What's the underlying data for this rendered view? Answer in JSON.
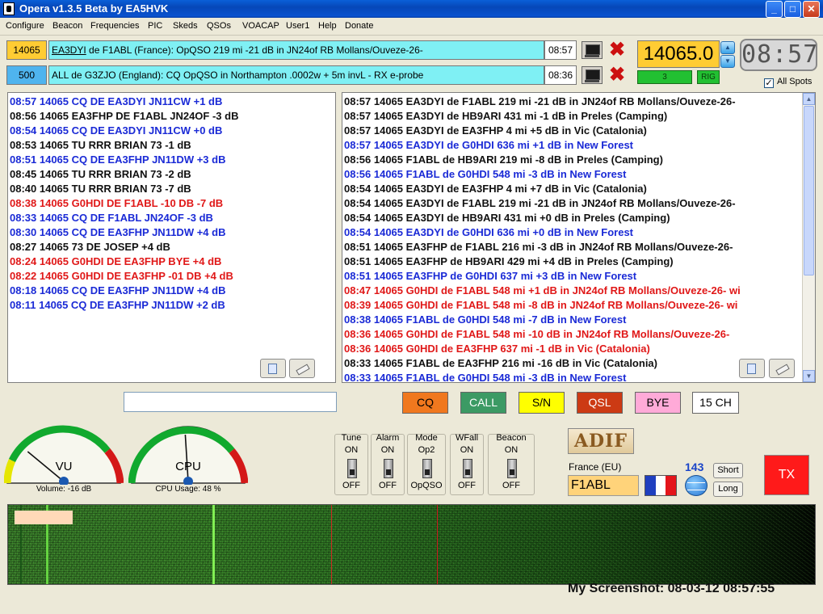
{
  "titlebar": {
    "title": "Opera v1.3.5 Beta    by EA5HVK",
    "min": "_",
    "max": "□",
    "close": "✕"
  },
  "menu": [
    "Configure",
    "Beacon",
    "Frequencies",
    "PIC",
    "Skeds",
    "QSOs",
    "VOACAP",
    "User1",
    "Help",
    "Donate"
  ],
  "rx1": {
    "freq": "14065",
    "freq_bg": "#ffcc33",
    "call": "EA3DYI",
    "message": " de F1ABL (France): OpQSO 219 mi -21 dB in JN24of RB Mollans/Ouveze-26-",
    "time": "08:57"
  },
  "rx2": {
    "freq": "500",
    "freq_bg": "#4fb4ee",
    "message": "ALL de G3ZJO (England): CQ OpQSO in Northampton .0002w + 5m invL - RX e-probe",
    "time": "08:36"
  },
  "frequency_display": "14065.0",
  "clock": "08:57",
  "rig_count": "3",
  "rig_label": "RIG",
  "all_spots": {
    "label": "All Spots",
    "checked": true
  },
  "left_log": [
    {
      "text": "08:57 14065 CQ DE EA3DYI JN11CW +1 dB",
      "color": "blue"
    },
    {
      "text": "08:56 14065 EA3FHP DE F1ABL JN24OF -3 dB",
      "color": "black"
    },
    {
      "text": "08:54 14065 CQ DE EA3DYI JN11CW +0 dB",
      "color": "blue"
    },
    {
      "text": "08:53 14065 TU RRR BRIAN 73 -1 dB",
      "color": "black"
    },
    {
      "text": "08:51 14065 CQ DE EA3FHP JN11DW +3 dB",
      "color": "blue"
    },
    {
      "text": "08:45 14065 TU RRR BRIAN 73 -2 dB",
      "color": "black"
    },
    {
      "text": "08:40 14065 TU RRR BRIAN 73 -7 dB",
      "color": "black"
    },
    {
      "text": "08:38 14065 G0HDI DE F1ABL -10 DB -7 dB",
      "color": "red"
    },
    {
      "text": "08:33 14065 CQ DE F1ABL JN24OF -3 dB",
      "color": "blue"
    },
    {
      "text": "08:30 14065 CQ DE EA3FHP JN11DW +4 dB",
      "color": "blue"
    },
    {
      "text": "08:27 14065 73 DE JOSEP      +4 dB",
      "color": "black"
    },
    {
      "text": "08:24 14065 G0HDI DE EA3FHP BYE +4 dB",
      "color": "red"
    },
    {
      "text": "08:22 14065 G0HDI DE EA3FHP -01 DB +4 dB",
      "color": "red"
    },
    {
      "text": "08:18 14065 CQ DE EA3FHP JN11DW +4 dB",
      "color": "blue"
    },
    {
      "text": "08:11 14065 CQ DE EA3FHP JN11DW +2 dB",
      "color": "blue"
    }
  ],
  "right_log": [
    {
      "text": "08:57 14065 EA3DYI de F1ABL 219 mi -21 dB in JN24of RB Mollans/Ouveze-26-",
      "color": "black"
    },
    {
      "text": "08:57 14065 EA3DYI de HB9ARI 431 mi -1 dB in Preles (Camping)",
      "color": "black"
    },
    {
      "text": "08:57 14065 EA3DYI de EA3FHP 4 mi +5 dB in Vic (Catalonia)",
      "color": "black"
    },
    {
      "text": "08:57 14065 EA3DYI de G0HDI 636 mi +1 dB in New Forest",
      "color": "blue"
    },
    {
      "text": "08:56 14065 F1ABL de HB9ARI 219 mi -8 dB in Preles (Camping)",
      "color": "black"
    },
    {
      "text": "08:56 14065 F1ABL de G0HDI 548 mi -3 dB in New Forest",
      "color": "blue"
    },
    {
      "text": "08:54 14065 EA3DYI de EA3FHP 4 mi +7 dB in Vic (Catalonia)",
      "color": "black"
    },
    {
      "text": "08:54 14065 EA3DYI de F1ABL 219 mi -21 dB in JN24of RB Mollans/Ouveze-26-",
      "color": "black"
    },
    {
      "text": "08:54 14065 EA3DYI de HB9ARI 431 mi +0 dB in Preles (Camping)",
      "color": "black"
    },
    {
      "text": "08:54 14065 EA3DYI de G0HDI 636 mi +0 dB in New Forest",
      "color": "blue"
    },
    {
      "text": "08:51 14065 EA3FHP de F1ABL 216 mi -3 dB in JN24of RB Mollans/Ouveze-26-",
      "color": "black"
    },
    {
      "text": "08:51 14065 EA3FHP de HB9ARI 429 mi +4 dB in Preles (Camping)",
      "color": "black"
    },
    {
      "text": "08:51 14065 EA3FHP de G0HDI 637 mi +3 dB in New Forest",
      "color": "blue"
    },
    {
      "text": "08:47 14065 G0HDI de F1ABL 548 mi +1 dB in JN24of RB Mollans/Ouveze-26- wi",
      "color": "red"
    },
    {
      "text": "08:39 14065 G0HDI de F1ABL 548 mi -8 dB in JN24of RB Mollans/Ouveze-26- wi",
      "color": "red"
    },
    {
      "text": "08:38 14065 F1ABL de G0HDI 548 mi -7 dB in New Forest",
      "color": "blue"
    },
    {
      "text": "08:36 14065 G0HDI de F1ABL 548 mi -10 dB in JN24of RB Mollans/Ouveze-26-",
      "color": "red"
    },
    {
      "text": "08:36 14065 G0HDI de EA3FHP 637 mi -1 dB in Vic (Catalonia)",
      "color": "red"
    },
    {
      "text": "08:33 14065 F1ABL de EA3FHP 216 mi -16 dB in Vic (Catalonia)",
      "color": "black"
    },
    {
      "text": "08:33 14065 F1ABL de G0HDI 548 mi -3 dB in New Forest",
      "color": "blue"
    }
  ],
  "tx_input": {
    "value": ""
  },
  "macros": [
    {
      "label": "CQ",
      "bg": "#f0781e"
    },
    {
      "label": "CALL",
      "bg": "#3c9a64"
    },
    {
      "label": "S/N",
      "bg": "#ffff00"
    },
    {
      "label": "QSL",
      "bg": "#cc3a14"
    },
    {
      "label": "BYE",
      "bg": "#ffaad8"
    },
    {
      "label": "15 CH",
      "bg": "#ffffff"
    }
  ],
  "gauges": {
    "vu": {
      "label": "VU",
      "caption": "Volume: -16 dB",
      "level": 0.22
    },
    "cpu": {
      "label": "CPU",
      "caption": "CPU Usage: 48 %",
      "level": 0.48
    }
  },
  "switches": [
    {
      "title": "Tune",
      "top": "ON",
      "bottom": "OFF"
    },
    {
      "title": "Alarm",
      "top": "ON",
      "bottom": "OFF"
    },
    {
      "title": "Mode",
      "top": "Op2",
      "bottom": "OpQSO"
    },
    {
      "title": "WFall",
      "top": "ON",
      "bottom": "OFF"
    },
    {
      "title": "Beacon",
      "top": "ON",
      "bottom": "OFF"
    }
  ],
  "adif_label": "ADIF",
  "station": {
    "country": "France (EU)",
    "call": "F1ABL",
    "distance": "143"
  },
  "path_buttons": {
    "short": "Short",
    "long": "Long"
  },
  "tx_label": "TX",
  "screenshot_caption": "My Screenshot: 08-03-12 08:57:55"
}
